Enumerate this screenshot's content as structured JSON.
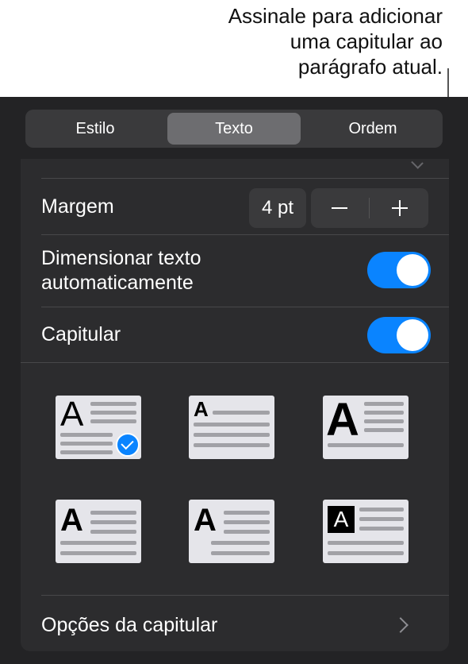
{
  "callout": {
    "line1": "Assinale para adicionar",
    "line2": "uma capitular ao",
    "line3": "parágrafo atual."
  },
  "tabs": [
    {
      "label": "Estilo",
      "selected": false
    },
    {
      "label": "Texto",
      "selected": true
    },
    {
      "label": "Ordem",
      "selected": false
    }
  ],
  "margin": {
    "label": "Margem",
    "value": "4 pt"
  },
  "autosize": {
    "line1": "Dimensionar texto",
    "line2": "automaticamente",
    "on": true
  },
  "dropcap": {
    "label": "Capitular",
    "on": true
  },
  "styles": {
    "letter": "A",
    "selected_index": 0
  },
  "options": {
    "label": "Opções da capitular"
  },
  "colors": {
    "accent": "#0a84ff",
    "panel": "#232325",
    "sheet": "#2c2c2e"
  }
}
